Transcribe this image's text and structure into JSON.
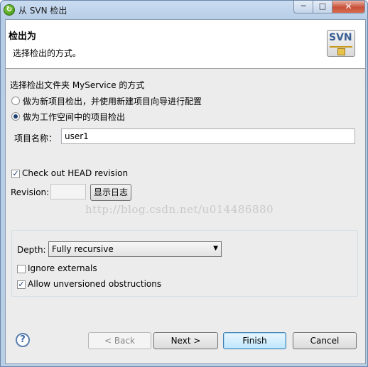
{
  "window": {
    "title": "从 SVN 检出",
    "min_glyph": "─",
    "max_glyph": "□",
    "close_glyph": "✕"
  },
  "header": {
    "title": "检出为",
    "description": "选择检出的方式。",
    "logo_text": "SVN"
  },
  "checkout": {
    "section_label": "选择检出文件夹 MyService 的方式",
    "option_new_project": "做为新项目检出，并使用新建项目向导进行配置",
    "option_workspace_project": "做为工作空间中的项目检出",
    "selected_option": "option_workspace_project",
    "project_name_label": "项目名称：",
    "project_name_value": "user1"
  },
  "revision": {
    "head_checkbox_label": "Check out HEAD revision",
    "head_checked": true,
    "revision_label": "Revision:",
    "revision_value": "",
    "show_log_button": "显示日志"
  },
  "options": {
    "depth_label": "Depth:",
    "depth_value": "Fully recursive",
    "ignore_externals_label": "Ignore externals",
    "ignore_externals_checked": false,
    "allow_unversioned_label": "Allow unversioned obstructions",
    "allow_unversioned_checked": true
  },
  "watermark": "http://blog.csdn.net/u014486880",
  "buttons": {
    "help": "?",
    "back": "< Back",
    "next": "Next >",
    "finish": "Finish",
    "cancel": "Cancel"
  },
  "colors": {
    "titlebar": "#c9dcf1",
    "close": "#c8513a",
    "accent": "#3c7fb1"
  }
}
